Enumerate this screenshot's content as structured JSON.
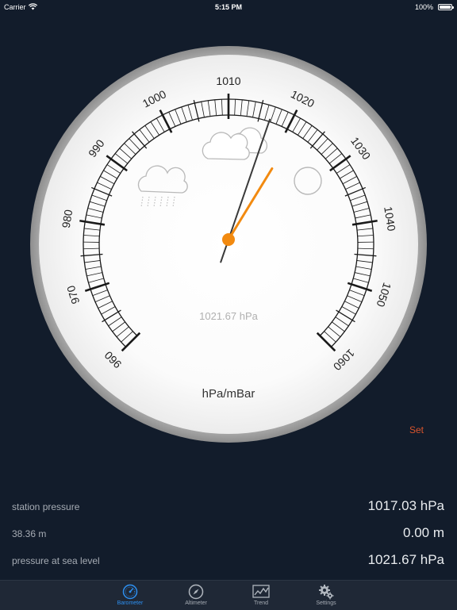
{
  "status_bar": {
    "carrier": "Carrier",
    "time": "5:15 PM",
    "battery": "100%",
    "battery_level": 1.0
  },
  "gauge": {
    "min": 960,
    "max": 1060,
    "major_labels": [
      "960",
      "970",
      "980",
      "990",
      "1000",
      "1010",
      "1020",
      "1030",
      "1040",
      "1050",
      "1060"
    ],
    "needle_value": 1021.67,
    "reference_value": 1017.03,
    "readout": "1021.67 hPa",
    "unit": "hPa/mBar",
    "icons": [
      "rain-cloud-icon",
      "cloud-icon",
      "sun-icon"
    ],
    "needle_color": "#f28a10",
    "face_color": "#ffffff",
    "rim_color": "#a6a6a6"
  },
  "set_label": "Set",
  "readings": [
    {
      "label": "station pressure",
      "value": "1017.03 hPa"
    },
    {
      "label": "38.36 m",
      "value": "0.00 m"
    },
    {
      "label": "pressure at sea level",
      "value": "1021.67 hPa"
    }
  ],
  "tabs": [
    {
      "label": "Barometer",
      "icon": "barometer-icon",
      "active": true
    },
    {
      "label": "Altimeter",
      "icon": "compass-icon",
      "active": false
    },
    {
      "label": "Trend",
      "icon": "trend-chart-icon",
      "active": false
    },
    {
      "label": "Settings",
      "icon": "gear-icon",
      "active": false
    }
  ],
  "colors": {
    "background": "#121c2b",
    "accent": "#2d8ff0",
    "set": "#d9542c"
  }
}
